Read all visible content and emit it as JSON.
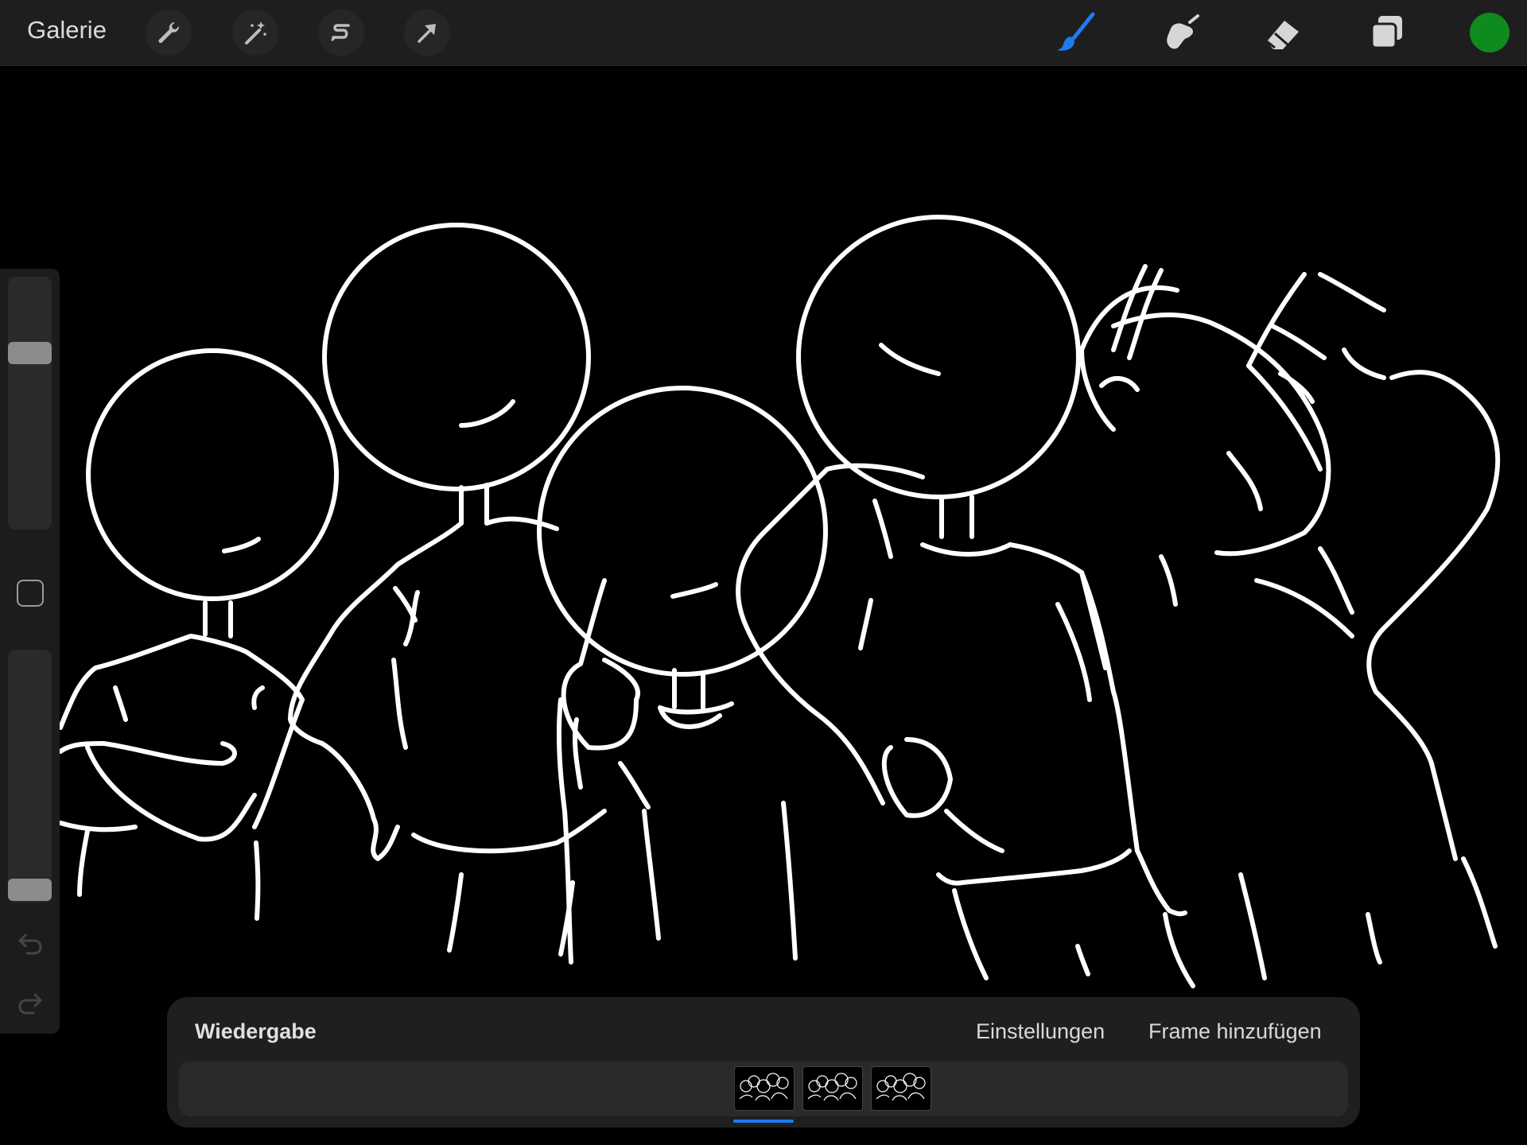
{
  "app": {
    "gallery_label": "Galerie",
    "accent_color": "#1e7bf0",
    "current_color": "#0f8a1f"
  },
  "toolbar_left": [
    {
      "name": "wrench-icon"
    },
    {
      "name": "magic-wand-icon"
    },
    {
      "name": "selection-s-icon"
    },
    {
      "name": "transform-arrow-icon"
    }
  ],
  "toolbar_right": [
    {
      "name": "brush-icon",
      "active": true
    },
    {
      "name": "smudge-icon",
      "active": false
    },
    {
      "name": "eraser-icon",
      "active": false
    },
    {
      "name": "layers-icon",
      "active": false
    }
  ],
  "sidebar": {
    "brush_size_level": 0.72,
    "opacity_level": 0.0,
    "modify_icon": "square-icon",
    "undo_icon": "undo-icon",
    "redo_icon": "redo-icon"
  },
  "animation": {
    "playback_label": "Wiedergabe",
    "settings_label": "Einstellungen",
    "add_frame_label": "Frame hinzufügen",
    "frame_count": 3,
    "selected_frame": 1
  }
}
